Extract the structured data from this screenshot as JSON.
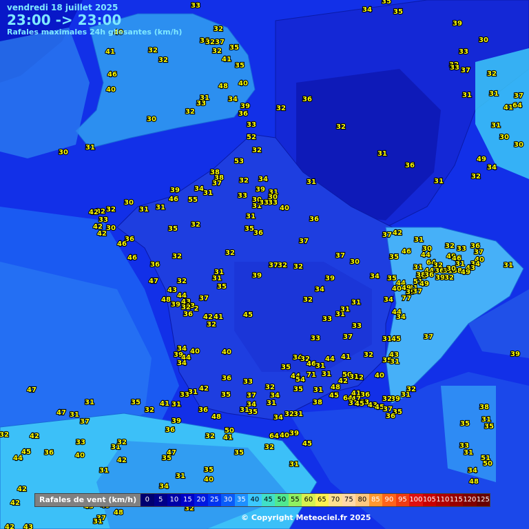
{
  "header": {
    "date": "vendredi 18 juillet 2025",
    "time_range": "23:00 -> 23:00",
    "subtitle": "Rafales maximales 24h glissantes (km/h)"
  },
  "legend": {
    "label": "Rafales de vent (km/h)",
    "steps": [
      {
        "v": "0",
        "c": "#000070",
        "t": "#fff"
      },
      {
        "v": "5",
        "c": "#00008a",
        "t": "#fff"
      },
      {
        "v": "10",
        "c": "#0000a8",
        "t": "#fff"
      },
      {
        "v": "15",
        "c": "#0000c8",
        "t": "#fff"
      },
      {
        "v": "20",
        "c": "#0018e0",
        "t": "#fff"
      },
      {
        "v": "25",
        "c": "#0034f0",
        "t": "#fff"
      },
      {
        "v": "30",
        "c": "#0a5cf8",
        "t": "#fff"
      },
      {
        "v": "35",
        "c": "#1e90ff",
        "t": "#fff"
      },
      {
        "v": "40",
        "c": "#3cc8ff",
        "t": "#000"
      },
      {
        "v": "45",
        "c": "#40e0c8",
        "t": "#000"
      },
      {
        "v": "50",
        "c": "#50e890",
        "t": "#000"
      },
      {
        "v": "55",
        "c": "#90f060",
        "t": "#000"
      },
      {
        "v": "60",
        "c": "#d8f050",
        "t": "#000"
      },
      {
        "v": "65",
        "c": "#fff050",
        "t": "#000"
      },
      {
        "v": "70",
        "c": "#ffe090",
        "t": "#000"
      },
      {
        "v": "75",
        "c": "#ffd8a8",
        "t": "#000"
      },
      {
        "v": "80",
        "c": "#ffc880",
        "t": "#000"
      },
      {
        "v": "85",
        "c": "#ff9830",
        "t": "#fff"
      },
      {
        "v": "90",
        "c": "#ff6418",
        "t": "#fff"
      },
      {
        "v": "95",
        "c": "#f03c10",
        "t": "#fff"
      },
      {
        "v": "100",
        "c": "#e01010",
        "t": "#fff"
      },
      {
        "v": "105",
        "c": "#c80000",
        "t": "#fff"
      },
      {
        "v": "110",
        "c": "#b00000",
        "t": "#fff"
      },
      {
        "v": "115",
        "c": "#980000",
        "t": "#fff"
      },
      {
        "v": "120",
        "c": "#800000",
        "t": "#fff"
      },
      {
        "v": "125",
        "c": "#680000",
        "t": "#fff"
      }
    ]
  },
  "copyright": "© Copyright Meteociel.fr 2025",
  "stations": [
    [
      "33",
      284,
      7
    ],
    [
      "34",
      533,
      13
    ],
    [
      "35",
      578,
      16
    ],
    [
      "35",
      561,
      1
    ],
    [
      "40",
      172,
      46
    ],
    [
      "32",
      317,
      41
    ],
    [
      "39",
      664,
      33
    ],
    [
      "30",
      702,
      57
    ],
    [
      "36",
      297,
      58
    ],
    [
      "37",
      319,
      60
    ],
    [
      "32",
      305,
      60
    ],
    [
      "41",
      160,
      74
    ],
    [
      "32",
      222,
      72
    ],
    [
      "35",
      340,
      68
    ],
    [
      "32",
      315,
      73
    ],
    [
      "33",
      673,
      74
    ],
    [
      "32",
      659,
      93
    ],
    [
      "37",
      676,
      101
    ],
    [
      "32",
      237,
      86
    ],
    [
      "41",
      329,
      85
    ],
    [
      "35",
      348,
      94
    ],
    [
      "32",
      714,
      106
    ],
    [
      "46",
      163,
      107
    ],
    [
      "33",
      660,
      97
    ],
    [
      "40",
      161,
      129
    ],
    [
      "48",
      324,
      124
    ],
    [
      "40",
      353,
      120
    ],
    [
      "31",
      297,
      141
    ],
    [
      "33",
      292,
      149
    ],
    [
      "34",
      338,
      143
    ],
    [
      "36",
      446,
      143
    ],
    [
      "31",
      678,
      137
    ],
    [
      "31",
      717,
      135
    ],
    [
      "37",
      753,
      138
    ],
    [
      "64",
      751,
      152
    ],
    [
      "41",
      738,
      155
    ],
    [
      "39",
      356,
      153
    ],
    [
      "36",
      353,
      164
    ],
    [
      "32",
      408,
      156
    ],
    [
      "32",
      276,
      161
    ],
    [
      "30",
      220,
      172
    ],
    [
      "33",
      365,
      180
    ],
    [
      "32",
      495,
      183
    ],
    [
      "31",
      720,
      181
    ],
    [
      "52",
      365,
      198
    ],
    [
      "30",
      732,
      198
    ],
    [
      "30",
      753,
      209
    ],
    [
      "30",
      92,
      220
    ],
    [
      "31",
      131,
      213
    ],
    [
      "32",
      373,
      217
    ],
    [
      "31",
      555,
      222
    ],
    [
      "53",
      347,
      233
    ],
    [
      "36",
      595,
      239
    ],
    [
      "49",
      699,
      230
    ],
    [
      "34",
      714,
      242
    ],
    [
      "38",
      312,
      249
    ],
    [
      "32",
      354,
      261
    ],
    [
      "34",
      382,
      259
    ],
    [
      "38",
      318,
      257
    ],
    [
      "37",
      315,
      265
    ],
    [
      "31",
      452,
      263
    ],
    [
      "32",
      691,
      255
    ],
    [
      "31",
      637,
      262
    ],
    [
      "39",
      378,
      274
    ],
    [
      "31",
      397,
      278
    ],
    [
      "39",
      254,
      275
    ],
    [
      "34",
      289,
      273
    ],
    [
      "31",
      302,
      279
    ],
    [
      "33",
      352,
      283
    ],
    [
      "30",
      396,
      285
    ],
    [
      "46",
      252,
      288
    ],
    [
      "55",
      280,
      289
    ],
    [
      "30",
      373,
      289
    ],
    [
      "33",
      396,
      293
    ],
    [
      "31",
      373,
      298
    ],
    [
      "33",
      383,
      293
    ],
    [
      "30",
      187,
      293
    ],
    [
      "32",
      146,
      306
    ],
    [
      "42",
      136,
      307
    ],
    [
      "32",
      161,
      303
    ],
    [
      "31",
      209,
      303
    ],
    [
      "31",
      233,
      300
    ],
    [
      "40",
      413,
      301
    ],
    [
      "33",
      150,
      318
    ],
    [
      "31",
      364,
      313
    ],
    [
      "36",
      456,
      317
    ],
    [
      "42",
      142,
      328
    ],
    [
      "30",
      161,
      330
    ],
    [
      "42",
      148,
      338
    ],
    [
      "35",
      251,
      331
    ],
    [
      "32",
      284,
      325
    ],
    [
      "35",
      362,
      331
    ],
    [
      "36",
      375,
      337
    ],
    [
      "37",
      562,
      340
    ],
    [
      "42",
      577,
      337
    ],
    [
      "31",
      608,
      347
    ],
    [
      "36",
      188,
      346
    ],
    [
      "46",
      177,
      353
    ],
    [
      "37",
      441,
      349
    ],
    [
      "32",
      653,
      356
    ],
    [
      "33",
      670,
      360
    ],
    [
      "36",
      690,
      356
    ],
    [
      "37",
      695,
      365
    ],
    [
      "46",
      590,
      364
    ],
    [
      "35",
      572,
      372
    ],
    [
      "30",
      620,
      360
    ],
    [
      "44",
      618,
      369
    ],
    [
      "49",
      655,
      371
    ],
    [
      "46",
      663,
      374
    ],
    [
      "40",
      696,
      376
    ],
    [
      "32",
      334,
      366
    ],
    [
      "37",
      494,
      370
    ],
    [
      "46",
      192,
      373
    ],
    [
      "32",
      257,
      371
    ],
    [
      "30",
      515,
      379
    ],
    [
      "31",
      668,
      382
    ],
    [
      "34",
      690,
      382
    ],
    [
      "64",
      626,
      380
    ],
    [
      "32",
      636,
      384
    ],
    [
      "38",
      664,
      392
    ],
    [
      "31",
      738,
      384
    ],
    [
      "36",
      225,
      383
    ],
    [
      "37",
      397,
      384
    ],
    [
      "32",
      410,
      384
    ],
    [
      "32",
      433,
      386
    ],
    [
      "31",
      607,
      387
    ],
    [
      "44",
      623,
      392
    ],
    [
      "36",
      638,
      392
    ],
    [
      "31",
      650,
      392
    ],
    [
      "30",
      655,
      389
    ],
    [
      "43",
      683,
      388
    ],
    [
      "49",
      676,
      394
    ],
    [
      "31",
      318,
      394
    ],
    [
      "39",
      373,
      399
    ],
    [
      "39",
      479,
      403
    ],
    [
      "34",
      544,
      400
    ],
    [
      "31",
      612,
      400
    ],
    [
      "38",
      611,
      398
    ],
    [
      "36",
      623,
      398
    ],
    [
      "39",
      639,
      402
    ],
    [
      "32",
      652,
      402
    ],
    [
      "47",
      223,
      407
    ],
    [
      "32",
      264,
      407
    ],
    [
      "31",
      315,
      403
    ],
    [
      "35",
      569,
      403
    ],
    [
      "51",
      607,
      408
    ],
    [
      "35",
      322,
      415
    ],
    [
      "34",
      464,
      419
    ],
    [
      "44",
      582,
      410
    ],
    [
      "31",
      600,
      417
    ],
    [
      "49",
      616,
      411
    ],
    [
      "49",
      590,
      417
    ],
    [
      "40",
      576,
      418
    ],
    [
      "39",
      596,
      423
    ],
    [
      "37",
      606,
      422
    ],
    [
      "43",
      250,
      420
    ],
    [
      "37",
      296,
      432
    ],
    [
      "32",
      447,
      434
    ],
    [
      "34",
      564,
      434
    ],
    [
      "77",
      590,
      432
    ],
    [
      "44",
      264,
      428
    ],
    [
      "39",
      255,
      441
    ],
    [
      "43",
      270,
      437
    ],
    [
      "43",
      276,
      443
    ],
    [
      "32",
      270,
      445
    ],
    [
      "2",
      285,
      447
    ],
    [
      "48",
      241,
      434
    ],
    [
      "31",
      517,
      438
    ],
    [
      "36",
      273,
      455
    ],
    [
      "31",
      494,
      455
    ],
    [
      "31",
      501,
      448
    ],
    [
      "42",
      302,
      459
    ],
    [
      "41",
      317,
      459
    ],
    [
      "45",
      360,
      456
    ],
    [
      "33",
      475,
      462
    ],
    [
      "44",
      576,
      452
    ],
    [
      "34",
      582,
      459
    ],
    [
      "32",
      307,
      470
    ],
    [
      "33",
      518,
      472
    ],
    [
      "33",
      458,
      490
    ],
    [
      "37",
      505,
      488
    ],
    [
      "31",
      562,
      491
    ],
    [
      "45",
      575,
      491
    ],
    [
      "37",
      622,
      488
    ],
    [
      "34",
      264,
      505
    ],
    [
      "40",
      283,
      509
    ],
    [
      "39",
      259,
      514
    ],
    [
      "44",
      270,
      518
    ],
    [
      "34",
      264,
      526
    ],
    [
      "40",
      329,
      510
    ],
    [
      "34",
      432,
      518
    ],
    [
      "32",
      443,
      520
    ],
    [
      "46",
      452,
      527
    ],
    [
      "31",
      465,
      530
    ],
    [
      "44",
      479,
      520
    ],
    [
      "41",
      502,
      517
    ],
    [
      "32",
      535,
      514
    ],
    [
      "35",
      562,
      522
    ],
    [
      "31",
      573,
      524
    ],
    [
      "43",
      572,
      514
    ],
    [
      "39",
      748,
      513
    ],
    [
      "35",
      415,
      532
    ],
    [
      "36",
      329,
      548
    ],
    [
      "33",
      360,
      553
    ],
    [
      "44",
      429,
      545
    ],
    [
      "54",
      436,
      550
    ],
    [
      "71",
      452,
      543
    ],
    [
      "31",
      474,
      542
    ],
    [
      "50",
      504,
      543
    ],
    [
      "42",
      521,
      547
    ],
    [
      "40",
      551,
      544
    ],
    [
      "42",
      498,
      552
    ],
    [
      "31",
      514,
      546
    ],
    [
      "32",
      597,
      564
    ],
    [
      "32",
      392,
      561
    ],
    [
      "41",
      517,
      570
    ],
    [
      "48",
      487,
      561
    ],
    [
      "31",
      462,
      565
    ],
    [
      "35",
      433,
      564
    ],
    [
      "37",
      365,
      573
    ],
    [
      "34",
      399,
      573
    ],
    [
      "36",
      530,
      572
    ],
    [
      "42",
      296,
      563
    ],
    [
      "31",
      280,
      568
    ],
    [
      "33",
      268,
      572
    ],
    [
      "35",
      328,
      572
    ],
    [
      "39",
      574,
      578
    ],
    [
      "32",
      562,
      578
    ],
    [
      "45",
      485,
      573
    ],
    [
      "64",
      505,
      577
    ],
    [
      "47",
      517,
      578
    ],
    [
      "31",
      589,
      572
    ],
    [
      "47",
      46,
      565
    ],
    [
      "31",
      130,
      583
    ],
    [
      "35",
      197,
      583
    ],
    [
      "41",
      239,
      585
    ],
    [
      "38",
      461,
      583
    ],
    [
      "31",
      513,
      584
    ],
    [
      "63",
      529,
      583
    ],
    [
      "43",
      541,
      587
    ],
    [
      "45",
      522,
      585
    ],
    [
      "45",
      551,
      590
    ],
    [
      "37",
      563,
      593
    ],
    [
      "32",
      420,
      600
    ],
    [
      "34",
      365,
      586
    ],
    [
      "35",
      367,
      597
    ],
    [
      "31",
      394,
      584
    ],
    [
      "32",
      217,
      594
    ],
    [
      "35",
      577,
      597
    ],
    [
      "36",
      567,
      603
    ],
    [
      "34",
      404,
      605
    ],
    [
      "31",
      433,
      600
    ],
    [
      "31",
      256,
      586
    ],
    [
      "31",
      355,
      594
    ],
    [
      "47",
      89,
      598
    ],
    [
      "31",
      108,
      601
    ],
    [
      "37",
      123,
      611
    ],
    [
      "39",
      256,
      610
    ],
    [
      "36",
      295,
      594
    ],
    [
      "48",
      314,
      604
    ],
    [
      "38",
      703,
      590
    ],
    [
      "31",
      706,
      608
    ],
    [
      "35",
      675,
      614
    ],
    [
      "35",
      710,
      618
    ],
    [
      "32",
      6,
      630
    ],
    [
      "42",
      50,
      632
    ],
    [
      "33",
      117,
      641
    ],
    [
      "31",
      168,
      648
    ],
    [
      "32",
      177,
      641
    ],
    [
      "36",
      247,
      623
    ],
    [
      "50",
      333,
      624
    ],
    [
      "41",
      331,
      634
    ],
    [
      "32",
      305,
      632
    ],
    [
      "64",
      398,
      632
    ],
    [
      "40",
      413,
      631
    ],
    [
      "39",
      427,
      628
    ],
    [
      "45",
      446,
      643
    ],
    [
      "32",
      391,
      648
    ],
    [
      "33",
      674,
      646
    ],
    [
      "31",
      680,
      656
    ],
    [
      "51",
      705,
      664
    ],
    [
      "50",
      708,
      672
    ],
    [
      "45",
      38,
      655
    ],
    [
      "36",
      71,
      656
    ],
    [
      "40",
      116,
      660
    ],
    [
      "47",
      249,
      656
    ],
    [
      "35",
      242,
      664
    ],
    [
      "42",
      177,
      667
    ],
    [
      "35",
      347,
      656
    ],
    [
      "44",
      26,
      664
    ],
    [
      "31",
      151,
      682
    ],
    [
      "35",
      303,
      681
    ],
    [
      "31",
      427,
      673
    ],
    [
      "40",
      303,
      695
    ],
    [
      "34",
      686,
      682
    ],
    [
      "31",
      262,
      690
    ],
    [
      "42",
      32,
      709
    ],
    [
      "48",
      688,
      698
    ],
    [
      "34",
      238,
      705
    ],
    [
      "42",
      22,
      729
    ],
    [
      "34",
      107,
      727
    ],
    [
      "49",
      153,
      733
    ],
    [
      "43",
      129,
      734
    ],
    [
      "32",
      275,
      737
    ],
    [
      "48",
      172,
      743
    ],
    [
      "37",
      147,
      751
    ],
    [
      "31",
      142,
      756
    ],
    [
      "42",
      14,
      764
    ],
    [
      "43",
      41,
      764
    ]
  ]
}
